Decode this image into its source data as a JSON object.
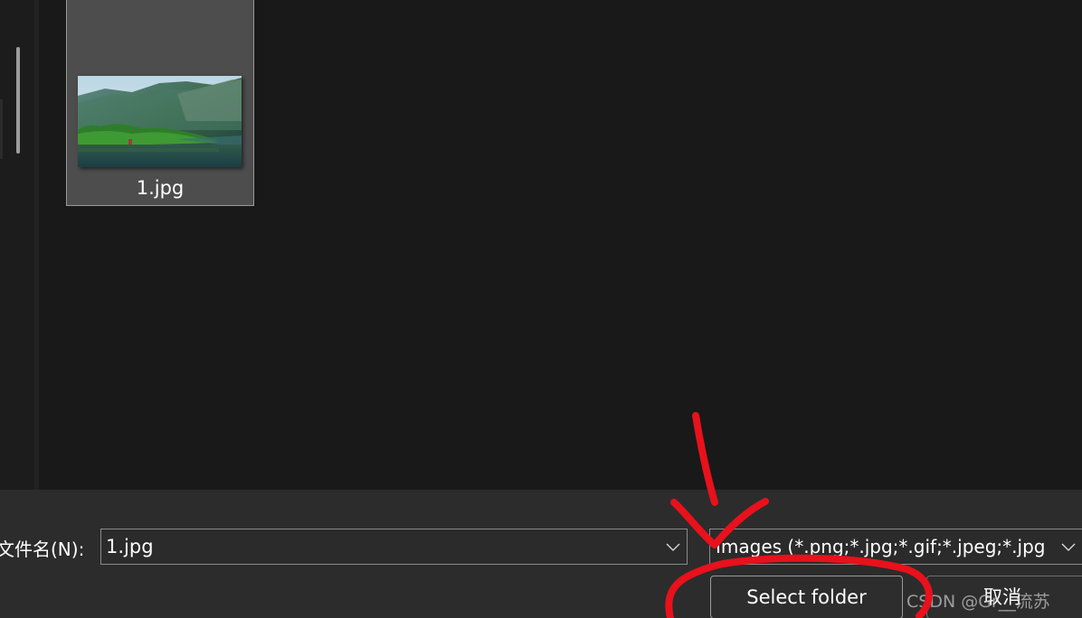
{
  "file_list": {
    "items": [
      {
        "name": "1.jpg",
        "thumbnail": "lake-mountains-landscape"
      }
    ]
  },
  "footer": {
    "filename_label": "文件名(N):",
    "filename_value": "1.jpg",
    "filetype_value": "Images (*.png;*.jpg;*.gif;*.jpeg;*.jpg",
    "select_button_label": "Select folder",
    "cancel_button_label": "取消"
  },
  "watermark": "CSDN @Gr__流苏",
  "icons": {
    "filename_dropdown": "chevron-down-icon",
    "filetype_dropdown": "chevron-down-icon"
  },
  "annotation": {
    "type": "hand-drawn red arrow and circle around Select folder button",
    "color": "#e8111c"
  },
  "colors": {
    "background": "#191919",
    "bottom_bar": "#2c2c2c",
    "selected_tile": "#4d4d4d",
    "annotation": "#e8111c"
  }
}
